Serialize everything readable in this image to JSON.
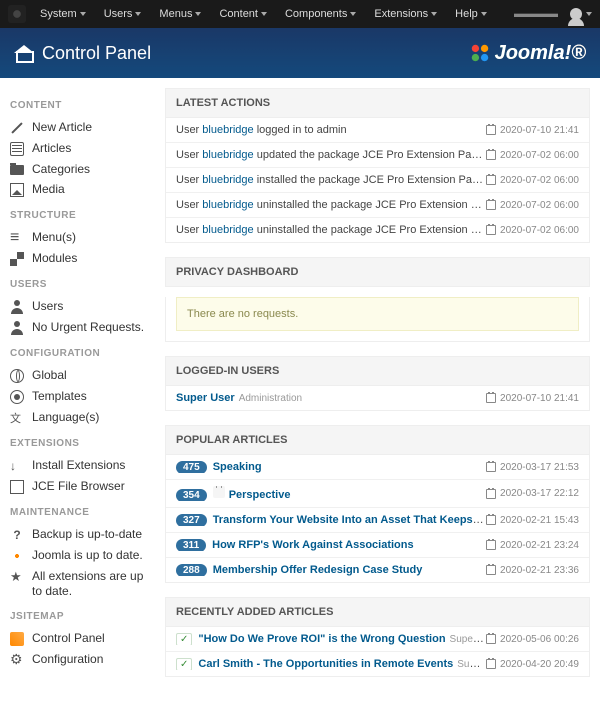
{
  "topnav": {
    "menus": [
      "System",
      "Users",
      "Menus",
      "Content",
      "Components",
      "Extensions",
      "Help"
    ],
    "user_indicator": "▾"
  },
  "header": {
    "title": "Control Panel",
    "brand": "Joomla!®"
  },
  "sidebar": {
    "sections": [
      {
        "heading": "CONTENT",
        "items": [
          {
            "icon": "i-pencil",
            "label": "New Article"
          },
          {
            "icon": "i-list",
            "label": "Articles"
          },
          {
            "icon": "i-folder",
            "label": "Categories"
          },
          {
            "icon": "i-img",
            "label": "Media"
          }
        ]
      },
      {
        "heading": "STRUCTURE",
        "items": [
          {
            "icon": "i-bars",
            "label": "Menu(s)"
          },
          {
            "icon": "i-grid",
            "label": "Modules"
          }
        ]
      },
      {
        "heading": "USERS",
        "items": [
          {
            "icon": "i-user",
            "label": "Users"
          },
          {
            "icon": "i-user",
            "label": "No Urgent Requests."
          }
        ]
      },
      {
        "heading": "CONFIGURATION",
        "items": [
          {
            "icon": "i-globe",
            "label": "Global"
          },
          {
            "icon": "i-eye",
            "label": "Templates"
          },
          {
            "icon": "i-lang",
            "label": "Language(s)"
          }
        ]
      },
      {
        "heading": "EXTENSIONS",
        "items": [
          {
            "icon": "i-down",
            "label": "Install Extensions"
          },
          {
            "icon": "i-browse",
            "label": "JCE File Browser"
          }
        ]
      },
      {
        "heading": "MAINTENANCE",
        "items": [
          {
            "icon": "i-q",
            "label": "Backup is up-to-date"
          },
          {
            "icon": "i-joomla",
            "label": "Joomla is up to date."
          },
          {
            "icon": "i-star",
            "label": "All extensions are up to date."
          }
        ]
      },
      {
        "heading": "JSITEMAP",
        "items": [
          {
            "icon": "i-panel",
            "label": "Control Panel"
          },
          {
            "icon": "i-cog",
            "label": "Configuration"
          }
        ]
      }
    ]
  },
  "latest_actions": {
    "heading": "LATEST ACTIONS",
    "rows": [
      {
        "pre": "User ",
        "user": "bluebridge",
        "post": " logged in to admin",
        "date": "2020-07-10 21:41"
      },
      {
        "pre": "User ",
        "user": "bluebridge",
        "post": " updated the package JCE Pro Extension Package",
        "date": "2020-07-02 06:00"
      },
      {
        "pre": "User ",
        "user": "bluebridge",
        "post": " installed the package JCE Pro Extension Package",
        "date": "2020-07-02 06:00"
      },
      {
        "pre": "User ",
        "user": "bluebridge",
        "post": " uninstalled the package JCE Pro Extension Package",
        "date": "2020-07-02 06:00"
      },
      {
        "pre": "User ",
        "user": "bluebridge",
        "post": " uninstalled the package JCE Pro Extension Package",
        "date": "2020-07-02 06:00"
      }
    ]
  },
  "privacy": {
    "heading": "PRIVACY DASHBOARD",
    "message": "There are no requests."
  },
  "logged_in": {
    "heading": "LOGGED-IN USERS",
    "rows": [
      {
        "user": "Super User",
        "area": "Administration",
        "date": "2020-07-10 21:41"
      }
    ]
  },
  "popular": {
    "heading": "POPULAR ARTICLES",
    "rows": [
      {
        "count": "475",
        "lock": false,
        "title": "Speaking",
        "date": "2020-03-17 21:53"
      },
      {
        "count": "354",
        "lock": true,
        "title": "Perspective",
        "date": "2020-03-17 22:12"
      },
      {
        "count": "327",
        "lock": false,
        "title": "Transform Your Website Into an Asset That Keeps Membe…",
        "date": "2020-02-21 15:43"
      },
      {
        "count": "311",
        "lock": false,
        "title": "How RFP's Work Against Associations",
        "date": "2020-02-21 23:24"
      },
      {
        "count": "288",
        "lock": false,
        "title": "Membership Offer Redesign Case Study",
        "date": "2020-02-21 23:36"
      }
    ]
  },
  "recent": {
    "heading": "RECENTLY ADDED ARTICLES",
    "rows": [
      {
        "title": "\"How Do We Prove ROI\" is the Wrong Question",
        "author": "Super User",
        "date": "2020-05-06 00:26"
      },
      {
        "title": "Carl Smith - The Opportunities in Remote Events",
        "author": "Super User",
        "date": "2020-04-20 20:49"
      }
    ]
  }
}
